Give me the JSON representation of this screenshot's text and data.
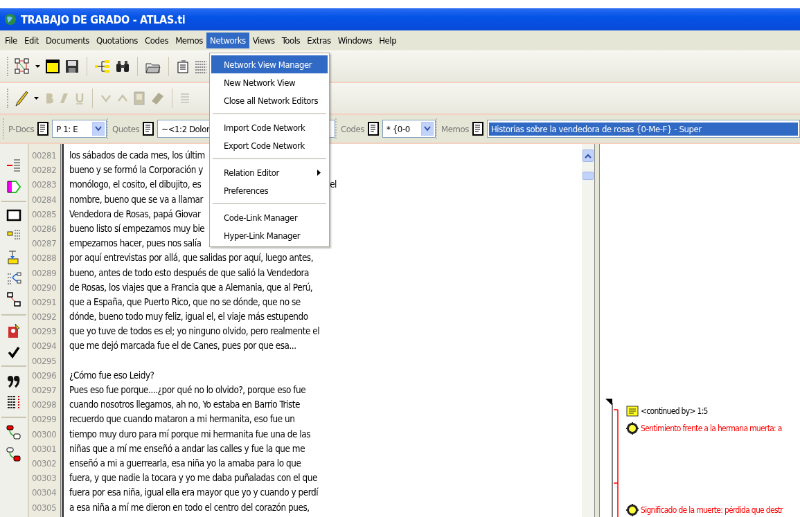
{
  "window": {
    "title": "TRABAJO DE GRADO - ATLAS.ti"
  },
  "menu_bar": [
    {
      "label": "File",
      "selected": false
    },
    {
      "label": "Edit",
      "selected": false
    },
    {
      "label": "Documents",
      "selected": false
    },
    {
      "label": "Quotations",
      "selected": false
    },
    {
      "label": "Codes",
      "selected": false
    },
    {
      "label": "Memos",
      "selected": false
    },
    {
      "label": "Networks",
      "selected": true
    },
    {
      "label": "Views",
      "selected": false
    },
    {
      "label": "Tools",
      "selected": false
    },
    {
      "label": "Extras",
      "selected": false
    },
    {
      "label": "Windows",
      "selected": false
    },
    {
      "label": "Help",
      "selected": false
    }
  ],
  "networks_menu": {
    "groups": [
      [
        {
          "label": "Network View  Manager",
          "selected": true,
          "submenu": false
        },
        {
          "label": "New Network View",
          "selected": false,
          "submenu": false
        },
        {
          "label": "Close all Network Editors",
          "selected": false,
          "submenu": false
        }
      ],
      [
        {
          "label": "Import Code Network",
          "selected": false,
          "submenu": false
        },
        {
          "label": "Export Code Network",
          "selected": false,
          "submenu": false
        }
      ],
      [
        {
          "label": "Relation Editor",
          "selected": false,
          "submenu": true
        },
        {
          "label": "Preferences",
          "selected": false,
          "submenu": false
        }
      ],
      [
        {
          "label": "Code-Link  Manager",
          "selected": false,
          "submenu": false
        },
        {
          "label": "Hyper-Link  Manager",
          "selected": false,
          "submenu": false
        }
      ]
    ]
  },
  "selectors": [
    {
      "label": "P-Docs",
      "value": "P 1: E",
      "kind": "combo",
      "highlighted": false
    },
    {
      "label": "Quotes",
      "value": "~<1:2 Dolor",
      "kind": "field",
      "highlighted": false
    },
    {
      "label": "Codes",
      "value": "* {0-0",
      "kind": "combo",
      "highlighted": false
    },
    {
      "label": "Memos",
      "value": "Historias sobre la vendedora de rosas {0-Me-F} - Super",
      "kind": "field",
      "highlighted": true
    }
  ],
  "document": {
    "lines": [
      {
        "number": "00281",
        "text": "los sábados de cada mes, los últim"
      },
      {
        "number": "00282",
        "text": "bueno y se formó la Corporación y"
      },
      {
        "number": "00283",
        "text": "monólogo, el cosito, el dibujito, es",
        "tail": "el"
      },
      {
        "number": "00284",
        "text": "nombre, bueno que se va a llamar"
      },
      {
        "number": "00285",
        "text": "Vendedora de Rosas, papá Giovar"
      },
      {
        "number": "00286",
        "text": "bueno listo sí empezamos muy bie"
      },
      {
        "number": "00287",
        "text": "empezamos hacer, pues nos salía"
      },
      {
        "number": "00288",
        "text": "por aquí entrevistas por allá, que salidas por aquí, luego antes,"
      },
      {
        "number": "00289",
        "text": "bueno, antes de todo esto después de que salió la Vendedora"
      },
      {
        "number": "00290",
        "text": "de Rosas, los viajes que a Francia que a Alemania, que al Perú,"
      },
      {
        "number": "00291",
        "text": "que a España, que Puerto Rico, que no se dónde, que no se"
      },
      {
        "number": "00292",
        "text": "dónde, bueno todo muy feliz, igual el, el viaje más estupendo"
      },
      {
        "number": "00293",
        "text": "que yo tuve de todos es el; yo ninguno olvido, pero realmente el"
      },
      {
        "number": "00294",
        "text": "que me dejó marcada fue el de Canes, pues por que esa..."
      },
      {
        "number": "00295"
      },
      {
        "number": "00296",
        "text": "¿Cómo fue eso Leidy?"
      },
      {
        "number": "00297",
        "text": "Pues eso fue porque....¿por qué no lo olvido?, porque eso fue"
      },
      {
        "number": "00298",
        "text": "cuando nosotros llegamos, ah no, Yo estaba en Barrio Triste"
      },
      {
        "number": "00299",
        "text": "recuerdo que cuando mataron a mi hermanita, eso fue un"
      },
      {
        "number": "00300",
        "text": "tiempo muy duro para mí porque mi hermanita fue una de las"
      },
      {
        "number": "00301",
        "text": "niñas que a mí me enseñó a andar las calles y fue la que me"
      },
      {
        "number": "00302",
        "text": "enseñó a mi a guerrearla, esa niña yo la amaba para lo que"
      },
      {
        "number": "00303",
        "text": "fuera, y que nadie la tocara y yo me daba puñaladas con el que"
      },
      {
        "number": "00304",
        "text": "fuera por esa niña, igual ella era mayor que yo y cuando y perdí"
      },
      {
        "number": "00305",
        "text": "a esa niña a mí me dieron en todo el centro del corazón pues,"
      }
    ]
  },
  "margin": {
    "items": [
      {
        "kind": "quotation",
        "text": "<continued by> 1:5"
      },
      {
        "kind": "code",
        "text": "Sentimiento frente a la hermana muerta:  a"
      },
      {
        "kind": "code",
        "text": "Significado de la muerte: pérdida que destr"
      }
    ]
  }
}
